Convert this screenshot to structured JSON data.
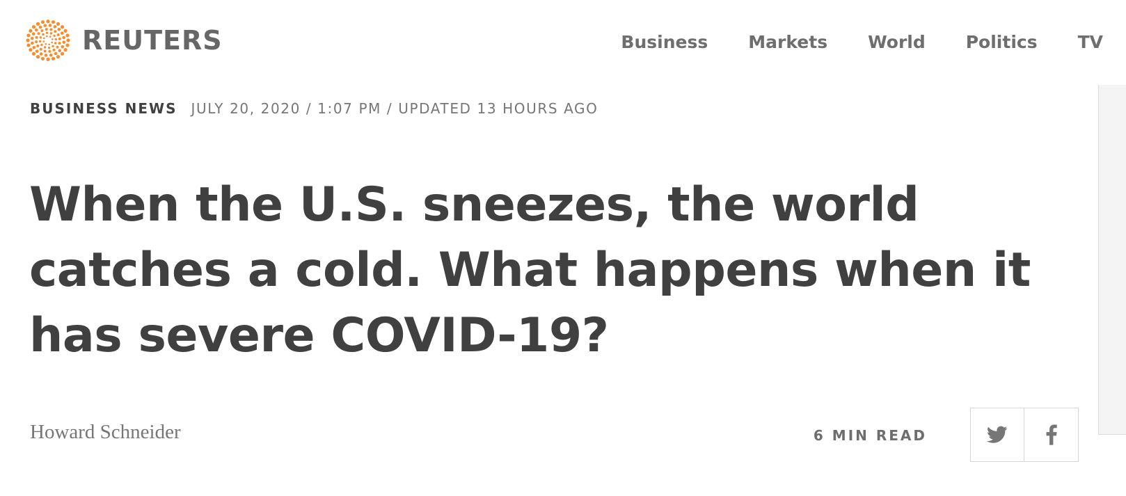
{
  "header": {
    "logo_text": "REUTERS",
    "brand_color": "#f68d2e",
    "logo_icon": "reuters-dot-logo"
  },
  "nav": {
    "items": [
      {
        "label": "Business"
      },
      {
        "label": "Markets"
      },
      {
        "label": "World"
      },
      {
        "label": "Politics"
      },
      {
        "label": "TV"
      }
    ]
  },
  "article": {
    "section": "BUSINESS NEWS",
    "dateline": "JULY 20, 2020 / 1:07 PM / UPDATED 13 HOURS AGO",
    "headline": "When the U.S. sneezes, the world catches a cold. What happens when it has severe COVID-19?",
    "author": "Howard Schneider",
    "read_time": "6 MIN READ"
  },
  "share": {
    "twitter_icon": "twitter-icon",
    "facebook_icon": "facebook-icon",
    "icon_color": "#767676"
  }
}
